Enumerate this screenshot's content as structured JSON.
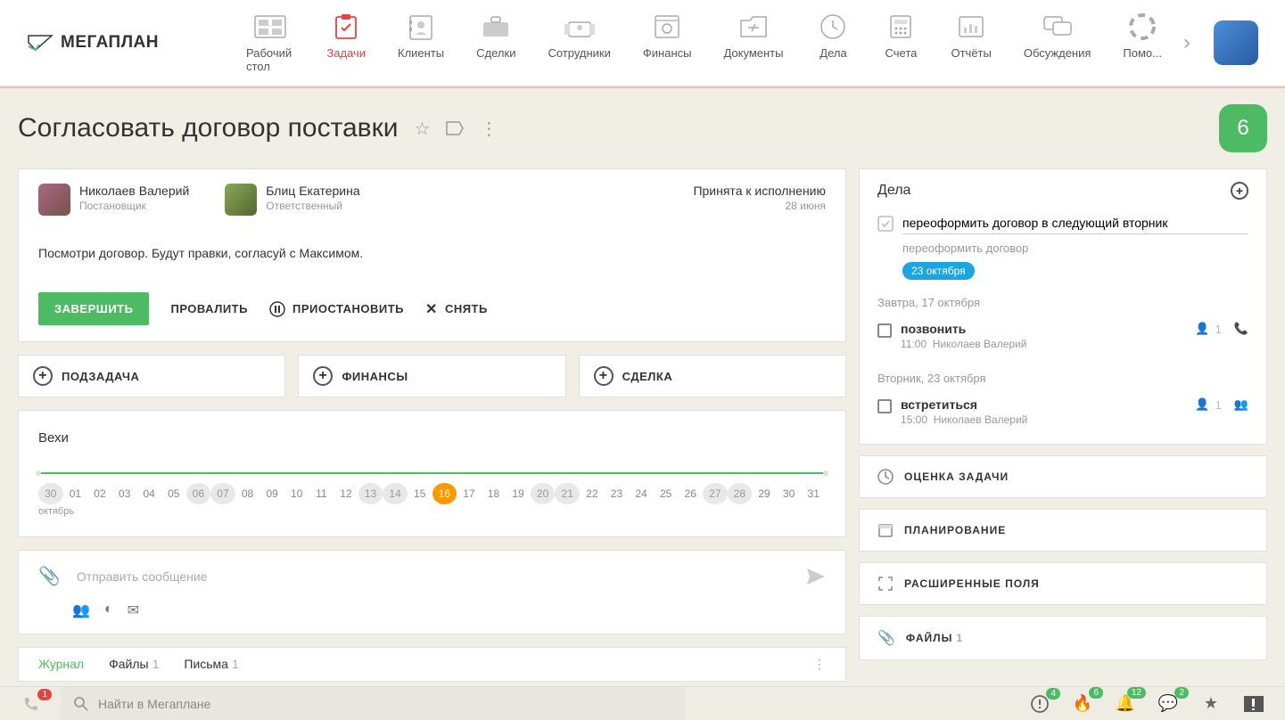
{
  "logo": {
    "text": "МЕГАПЛАН"
  },
  "nav": {
    "items": [
      {
        "label": "Рабочий стол"
      },
      {
        "label": "Задачи"
      },
      {
        "label": "Клиенты"
      },
      {
        "label": "Сделки"
      },
      {
        "label": "Сотрудники"
      },
      {
        "label": "Финансы"
      },
      {
        "label": "Документы"
      },
      {
        "label": "Дела"
      },
      {
        "label": "Счета"
      },
      {
        "label": "Отчёты"
      },
      {
        "label": "Обсуждения"
      },
      {
        "label": "Помо..."
      }
    ]
  },
  "header": {
    "title": "Согласовать договор поставки",
    "participants_count": "6"
  },
  "people": {
    "owner": {
      "name": "Николаев Валерий",
      "role": "Постановщик"
    },
    "assignee": {
      "name": "Блиц Екатерина",
      "role": "Ответственный"
    },
    "status": "Принята к исполнению",
    "status_date": "28 июня"
  },
  "description": "Посмотри договор. Будут правки, согласуй с Максимом.",
  "actions": {
    "complete": "ЗАВЕРШИТЬ",
    "fail": "ПРОВАЛИТЬ",
    "pause": "ПРИОСТАНОВИТЬ",
    "cancel": "СНЯТЬ"
  },
  "quick_add": {
    "subtask": "ПОДЗАДАЧА",
    "finance": "ФИНАНСЫ",
    "deal": "СДЕЛКА"
  },
  "milestones": {
    "title": "Вехи",
    "month": "октябрь",
    "days": [
      "30",
      "01",
      "02",
      "03",
      "04",
      "05",
      "06",
      "07",
      "08",
      "09",
      "10",
      "11",
      "12",
      "13",
      "14",
      "15",
      "16",
      "17",
      "18",
      "19",
      "20",
      "21",
      "22",
      "23",
      "24",
      "25",
      "26",
      "27",
      "28",
      "29",
      "30",
      "31"
    ],
    "muted_indices": [
      0,
      6,
      7,
      13,
      14,
      20,
      21,
      27,
      28
    ],
    "today_index": 16
  },
  "composer": {
    "placeholder": "Отправить сообщение"
  },
  "tabs": {
    "journal": {
      "label": "Журнал"
    },
    "files": {
      "label": "Файлы",
      "count": "1"
    },
    "letters": {
      "label": "Письма",
      "count": "1"
    }
  },
  "dela": {
    "title": "Дела",
    "input_value": "переоформить договор в следующий вторник",
    "hint": "переоформить договор",
    "pill": "23 октября",
    "groups": [
      {
        "title": "Завтра, 17 октября",
        "items": [
          {
            "title": "позвонить",
            "time": "11:00",
            "who": "Николаев Валерий",
            "people": "1",
            "icon": "call"
          }
        ]
      },
      {
        "title": "Вторник, 23 октября",
        "items": [
          {
            "title": "встретиться",
            "time": "15:00",
            "who": "Николаев Валерий",
            "people": "1",
            "icon": "meet"
          }
        ]
      }
    ]
  },
  "right_sections": {
    "rating": "ОЦЕНКА ЗАДАЧИ",
    "planning": "ПЛАНИРОВАНИЕ",
    "extended": "РАСШИРЕННЫЕ ПОЛЯ",
    "files": "ФАЙЛЫ",
    "files_count": "1"
  },
  "bottombar": {
    "phone_badge": "1",
    "search_placeholder": "Найти в Мегаплане",
    "alerts": "4",
    "fire": "6",
    "bell": "12",
    "chat": "2"
  }
}
